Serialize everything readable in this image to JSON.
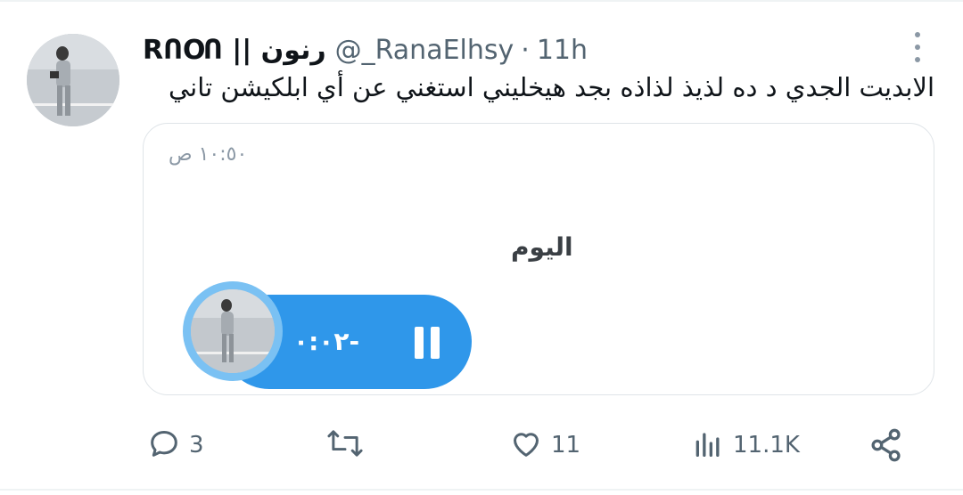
{
  "tweet": {
    "display_name": "RՈՕՈ || رنون",
    "handle": "@_RanaElhsy",
    "separator": "·",
    "time_ago": "11h",
    "text": "الابديت الجدي د ده لذيذ لذاذه بجد هيخليني استغني عن أي ابلكيشن تاني"
  },
  "card": {
    "time": "١٠:٥٠ ص",
    "day_label": "اليوم",
    "voice_duration": "-٠:٠٢"
  },
  "actions": {
    "replies": "3",
    "likes": "11",
    "views": "11.1K"
  },
  "icons": {
    "reply": "reply-icon",
    "retweet": "retweet-icon",
    "like": "heart-icon",
    "views": "views-icon",
    "share": "share-icon",
    "more": "more-icon",
    "pause": "pause-icon"
  },
  "colors": {
    "accent": "#2f97ea",
    "text": "#0f1419",
    "muted": "#536471"
  }
}
